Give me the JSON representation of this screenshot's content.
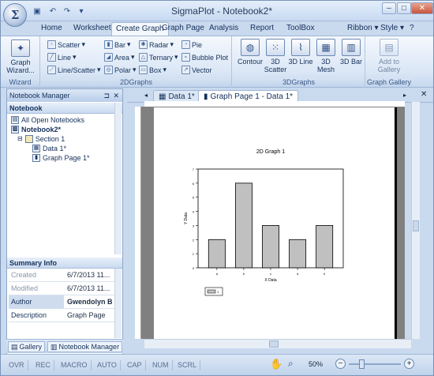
{
  "window": {
    "title": "SigmaPlot - Notebook2*",
    "orb": "Σ"
  },
  "ribbon_tabs": [
    "Home",
    "Worksheet",
    "Create Graph",
    "Graph Page",
    "Analysis",
    "Report",
    "ToolBox"
  ],
  "ribbon_right": {
    "ribbon": "Ribbon",
    "style": "Style",
    "help": "?"
  },
  "wizard": {
    "label": "Graph Wizard...",
    "group": "Wizard"
  },
  "twod": {
    "group": "2DGraphs",
    "items": [
      [
        "Scatter",
        "Bar",
        "Radar",
        "Pie"
      ],
      [
        "Line",
        "Area",
        "Ternary",
        "Bubble Plot"
      ],
      [
        "Line/Scatter",
        "Polar",
        "Box",
        "Vector"
      ]
    ]
  },
  "threed": {
    "group": "3DGraphs",
    "items": [
      "Contour",
      "3D Scatter",
      "3D Line",
      "3D Mesh",
      "3D Bar"
    ]
  },
  "gallery": {
    "group": "Graph Gallery",
    "label": "Add to Gallery"
  },
  "notebook_manager": {
    "title": "Notebook Manager",
    "section": "Notebook",
    "tree": [
      "All Open Notebooks",
      "Notebook2*",
      "Section 1",
      "Data 1*",
      "Graph Page 1*"
    ]
  },
  "summary": {
    "title": "Summary Info",
    "rows": [
      {
        "k": "Created",
        "v": "6/7/2013 11..."
      },
      {
        "k": "Modified",
        "v": "6/7/2013 11..."
      },
      {
        "k": "Author",
        "v": "Gwendolyn B"
      },
      {
        "k": "Description",
        "v": "Graph Page"
      }
    ]
  },
  "bottom_tabs": [
    "Gallery",
    "Notebook Manager"
  ],
  "doc_tabs": [
    "Data 1*",
    "Graph Page 1 - Data 1*"
  ],
  "status": [
    "OVR",
    "REC",
    "MACRO",
    "AUTO",
    "CAP",
    "NUM",
    "SCRL"
  ],
  "zoom": "50%",
  "chart_data": {
    "type": "bar",
    "title": "2D Graph 1",
    "xlabel": "X Data",
    "ylabel": "Y Data",
    "categories": [
      "a",
      "b",
      "c",
      "d",
      "e"
    ],
    "values": [
      2,
      6,
      3,
      2,
      3
    ],
    "ylim": [
      0,
      7
    ],
    "legend": [
      "1"
    ]
  }
}
